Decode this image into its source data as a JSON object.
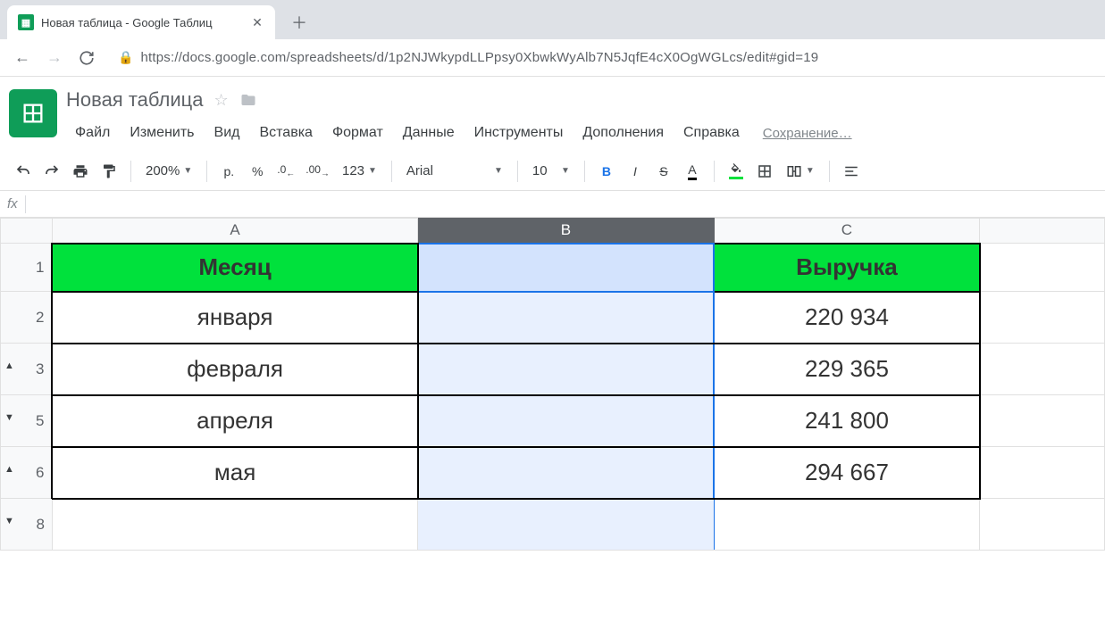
{
  "browser": {
    "tab_title": "Новая таблица - Google Таблиц",
    "url": "https://docs.google.com/spreadsheets/d/1p2NJWkypdLLPpsy0XbwkWyAlb7N5JqfE4cX0OgWGLcs/edit#gid=19"
  },
  "header": {
    "doc_title": "Новая таблица",
    "saving_text": "Сохранение…"
  },
  "menu": {
    "file": "Файл",
    "edit": "Изменить",
    "view": "Вид",
    "insert": "Вставка",
    "format": "Формат",
    "data": "Данные",
    "tools": "Инструменты",
    "addons": "Дополнения",
    "help": "Справка"
  },
  "toolbar": {
    "zoom": "200%",
    "currency": "р.",
    "percent": "%",
    "dec_dec": ".0",
    "inc_dec": ".00",
    "num_fmt": "123",
    "font": "Arial",
    "font_size": "10",
    "bold": "B",
    "italic": "I",
    "strike": "S",
    "text_color": "A"
  },
  "grid": {
    "columns": [
      "A",
      "B",
      "C"
    ],
    "selected_column": "B",
    "row_labels": [
      "1",
      "2",
      "3",
      "5",
      "6",
      "8"
    ],
    "row_groups": [
      "",
      "",
      "▲",
      "▼",
      "▲",
      "▼"
    ],
    "header_row": {
      "a": "Месяц",
      "b": "",
      "c": "Выручка"
    },
    "data_rows": [
      {
        "a": "января",
        "b": "",
        "c": "220 934"
      },
      {
        "a": "февраля",
        "b": "",
        "c": "229 365"
      },
      {
        "a": "апреля",
        "b": "",
        "c": "241 800"
      },
      {
        "a": "мая",
        "b": "",
        "c": "294 667"
      }
    ]
  }
}
